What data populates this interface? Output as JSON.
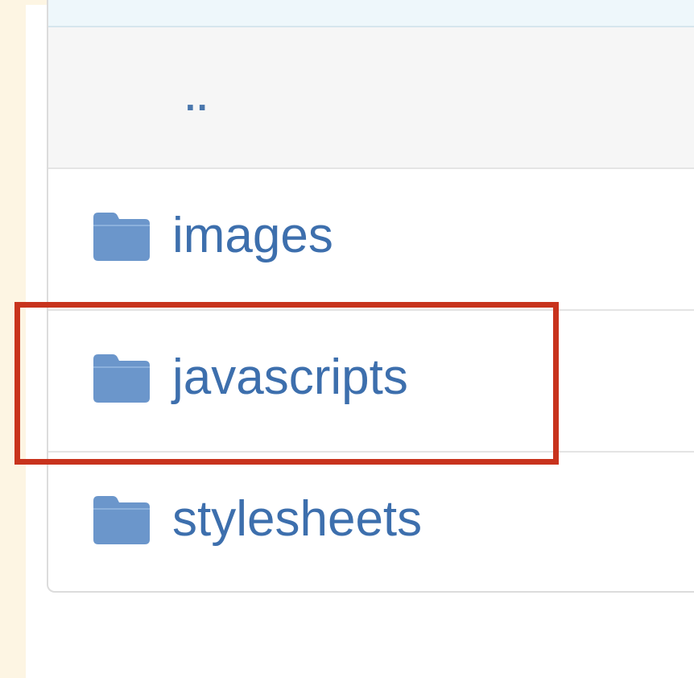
{
  "colors": {
    "link": "#3d6fad",
    "folder": "#6b96cb",
    "highlight": "#c8331d",
    "page_margin": "#fdf5e3"
  },
  "file_list": {
    "parent_label": "..",
    "entries": [
      {
        "label": "images",
        "icon": "folder-icon"
      },
      {
        "label": "javascripts",
        "icon": "folder-icon",
        "highlighted": true
      },
      {
        "label": "stylesheets",
        "icon": "folder-icon"
      }
    ]
  }
}
